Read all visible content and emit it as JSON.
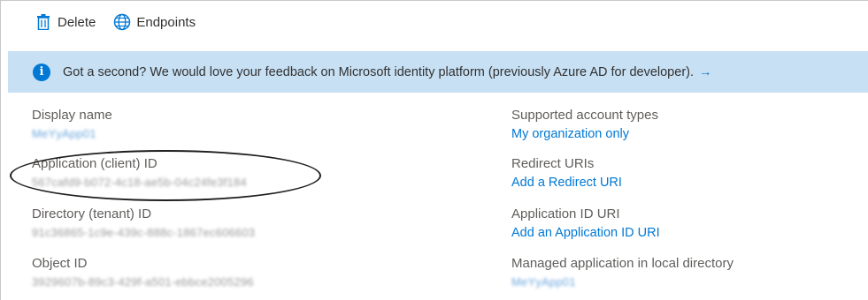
{
  "toolbar": {
    "delete_label": "Delete",
    "endpoints_label": "Endpoints",
    "delete_icon": "trash-icon",
    "endpoints_icon": "globe-icon"
  },
  "banner": {
    "text": "Got a second? We would love your feedback on Microsoft identity platform (previously Azure AD for developer).",
    "arrow": "→",
    "icon": "info-icon"
  },
  "properties": {
    "display_name": {
      "label": "Display name",
      "value": "MeYyApp01"
    },
    "client_id": {
      "label": "Application (client) ID",
      "value": "567cafd9-b072-4c18-ae5b-04c24fe3f184"
    },
    "tenant_id": {
      "label": "Directory (tenant) ID",
      "value": "91c36865-1c9e-439c-888c-1867ec606603"
    },
    "object_id": {
      "label": "Object ID",
      "value": "3929607b-89c3-429f-a501-ebbce2005296"
    },
    "account_types": {
      "label": "Supported account types",
      "value": "My organization only"
    },
    "redirect_uris": {
      "label": "Redirect URIs",
      "value": "Add a Redirect URI"
    },
    "app_id_uri": {
      "label": "Application ID URI",
      "value": "Add an Application ID URI"
    },
    "managed_app": {
      "label": "Managed application in local directory",
      "value": "MeYyApp01"
    }
  },
  "colors": {
    "accent": "#0078d4",
    "banner_bg": "#c7e0f4"
  }
}
